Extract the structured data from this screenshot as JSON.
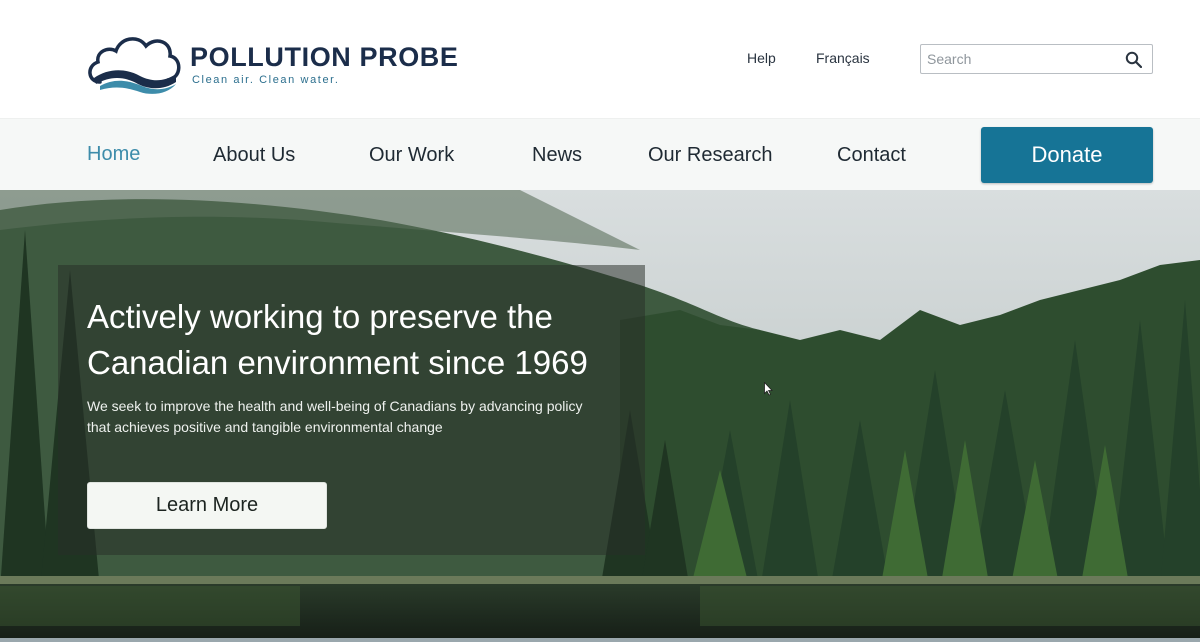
{
  "brand": {
    "name": "POLLUTION PROBE",
    "tagline": "Clean air. Clean water.",
    "colors": {
      "navy": "#1b2d4a",
      "teal": "#2c6f8e",
      "accent_blue": "#3d8caa"
    }
  },
  "utility_nav": {
    "help": "Help",
    "language": "Français",
    "search": {
      "placeholder": "Search",
      "value": "",
      "icon": "search-icon"
    }
  },
  "main_nav": {
    "items": [
      {
        "label": "Home",
        "active": true
      },
      {
        "label": "About Us",
        "active": false
      },
      {
        "label": "Our Work",
        "active": false
      },
      {
        "label": "News",
        "active": false
      },
      {
        "label": "Our Research",
        "active": false
      },
      {
        "label": "Contact",
        "active": false
      }
    ],
    "donate_label": "Donate",
    "donate_color": "#167496"
  },
  "hero": {
    "title": "Actively working to preserve the Canadian environment since 1969",
    "subtitle": "We seek to improve the health and well-being of Canadians by advancing policy that achieves positive and tangible environmental change",
    "cta_label": "Learn More"
  }
}
